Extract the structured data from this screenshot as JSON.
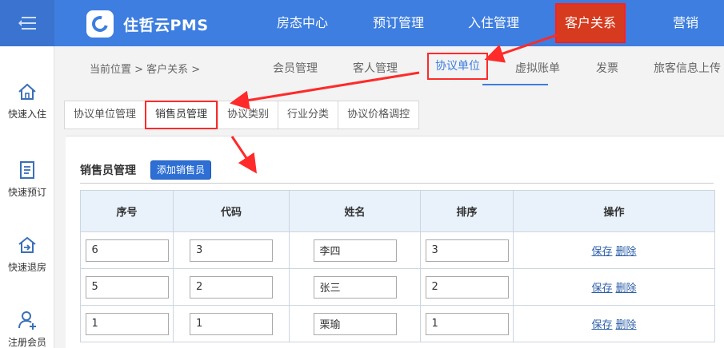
{
  "app": {
    "title": "住哲云PMS"
  },
  "top_nav": [
    {
      "label": "房态中心"
    },
    {
      "label": "预订管理"
    },
    {
      "label": "入住管理"
    },
    {
      "label": "客户关系"
    },
    {
      "label": "营销"
    }
  ],
  "sidebar": [
    {
      "label": "快速入住",
      "icon": "home-icon"
    },
    {
      "label": "快速预订",
      "icon": "document-icon"
    },
    {
      "label": "快速退房",
      "icon": "checkout-house-icon"
    },
    {
      "label": "注册会员",
      "icon": "add-user-icon"
    }
  ],
  "breadcrumb": "当前位置 > 客户关系 >",
  "sub_tabs": [
    {
      "label": "会员管理"
    },
    {
      "label": "客人管理"
    },
    {
      "label": "协议单位"
    },
    {
      "label": "虚拟账单"
    },
    {
      "label": "发票"
    },
    {
      "label": "旅客信息上传"
    }
  ],
  "content_tabs": [
    {
      "label": "协议单位管理"
    },
    {
      "label": "销售员管理"
    },
    {
      "label": "协议类别"
    },
    {
      "label": "行业分类"
    },
    {
      "label": "协议价格调控"
    }
  ],
  "panel": {
    "title": "销售员管理",
    "add_button": "添加销售员"
  },
  "table": {
    "headers": [
      "序号",
      "代码",
      "姓名",
      "排序",
      "操作"
    ],
    "rows": [
      {
        "seq": "6",
        "code": "3",
        "name": "李四",
        "order": "3"
      },
      {
        "seq": "5",
        "code": "2",
        "name": "张三",
        "order": "2"
      },
      {
        "seq": "1",
        "code": "1",
        "name": "栗瑜",
        "order": "1"
      }
    ],
    "save_label": "保存",
    "delete_label": "删除"
  },
  "colors": {
    "brand": "#3d7ee0",
    "active_nav": "#d73b1f",
    "highlight": "#ff2a2a",
    "link": "#2d5ea8"
  }
}
